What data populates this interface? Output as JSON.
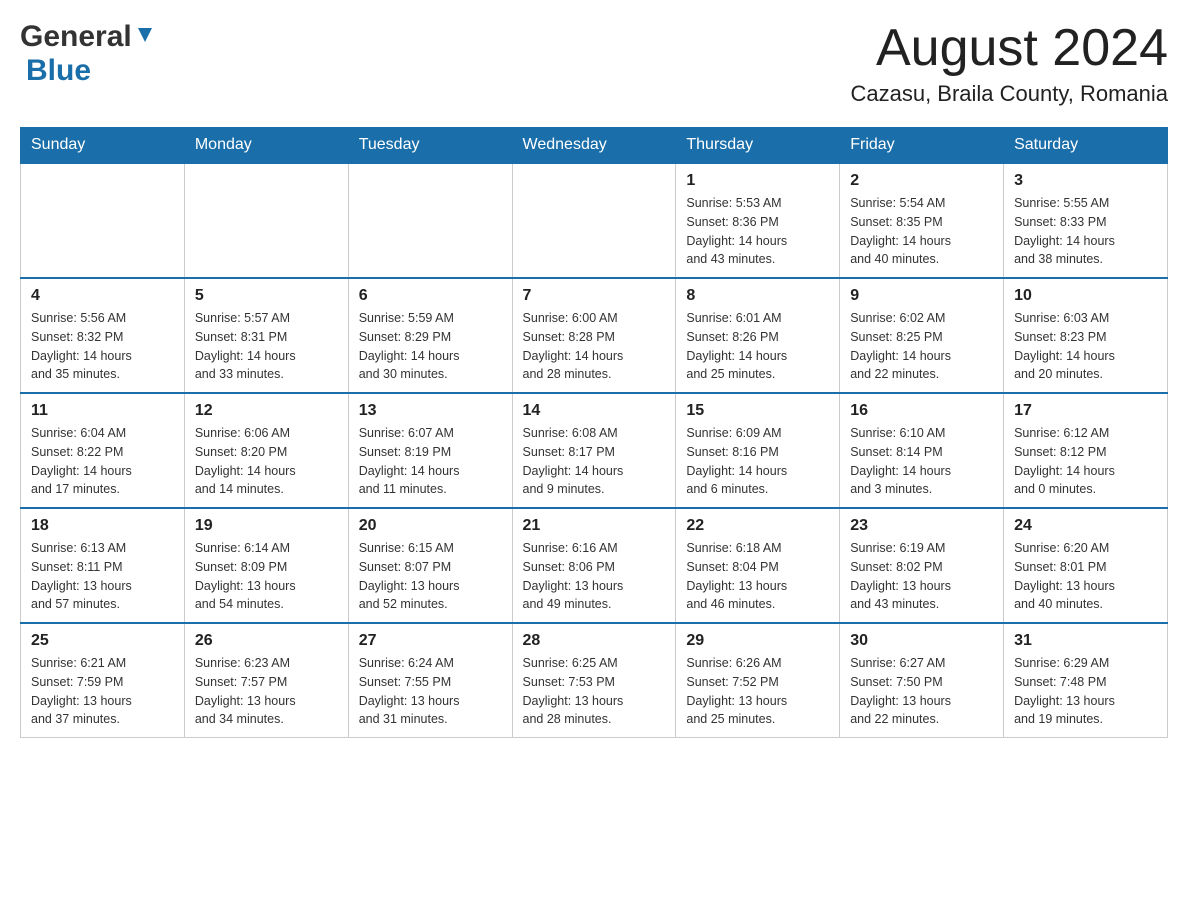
{
  "header": {
    "logo": {
      "general": "General",
      "blue": "Blue"
    },
    "title": "August 2024",
    "location": "Cazasu, Braila County, Romania"
  },
  "calendar": {
    "days_of_week": [
      "Sunday",
      "Monday",
      "Tuesday",
      "Wednesday",
      "Thursday",
      "Friday",
      "Saturday"
    ],
    "weeks": [
      {
        "days": [
          {
            "num": "",
            "info": ""
          },
          {
            "num": "",
            "info": ""
          },
          {
            "num": "",
            "info": ""
          },
          {
            "num": "",
            "info": ""
          },
          {
            "num": "1",
            "info": "Sunrise: 5:53 AM\nSunset: 8:36 PM\nDaylight: 14 hours\nand 43 minutes."
          },
          {
            "num": "2",
            "info": "Sunrise: 5:54 AM\nSunset: 8:35 PM\nDaylight: 14 hours\nand 40 minutes."
          },
          {
            "num": "3",
            "info": "Sunrise: 5:55 AM\nSunset: 8:33 PM\nDaylight: 14 hours\nand 38 minutes."
          }
        ]
      },
      {
        "days": [
          {
            "num": "4",
            "info": "Sunrise: 5:56 AM\nSunset: 8:32 PM\nDaylight: 14 hours\nand 35 minutes."
          },
          {
            "num": "5",
            "info": "Sunrise: 5:57 AM\nSunset: 8:31 PM\nDaylight: 14 hours\nand 33 minutes."
          },
          {
            "num": "6",
            "info": "Sunrise: 5:59 AM\nSunset: 8:29 PM\nDaylight: 14 hours\nand 30 minutes."
          },
          {
            "num": "7",
            "info": "Sunrise: 6:00 AM\nSunset: 8:28 PM\nDaylight: 14 hours\nand 28 minutes."
          },
          {
            "num": "8",
            "info": "Sunrise: 6:01 AM\nSunset: 8:26 PM\nDaylight: 14 hours\nand 25 minutes."
          },
          {
            "num": "9",
            "info": "Sunrise: 6:02 AM\nSunset: 8:25 PM\nDaylight: 14 hours\nand 22 minutes."
          },
          {
            "num": "10",
            "info": "Sunrise: 6:03 AM\nSunset: 8:23 PM\nDaylight: 14 hours\nand 20 minutes."
          }
        ]
      },
      {
        "days": [
          {
            "num": "11",
            "info": "Sunrise: 6:04 AM\nSunset: 8:22 PM\nDaylight: 14 hours\nand 17 minutes."
          },
          {
            "num": "12",
            "info": "Sunrise: 6:06 AM\nSunset: 8:20 PM\nDaylight: 14 hours\nand 14 minutes."
          },
          {
            "num": "13",
            "info": "Sunrise: 6:07 AM\nSunset: 8:19 PM\nDaylight: 14 hours\nand 11 minutes."
          },
          {
            "num": "14",
            "info": "Sunrise: 6:08 AM\nSunset: 8:17 PM\nDaylight: 14 hours\nand 9 minutes."
          },
          {
            "num": "15",
            "info": "Sunrise: 6:09 AM\nSunset: 8:16 PM\nDaylight: 14 hours\nand 6 minutes."
          },
          {
            "num": "16",
            "info": "Sunrise: 6:10 AM\nSunset: 8:14 PM\nDaylight: 14 hours\nand 3 minutes."
          },
          {
            "num": "17",
            "info": "Sunrise: 6:12 AM\nSunset: 8:12 PM\nDaylight: 14 hours\nand 0 minutes."
          }
        ]
      },
      {
        "days": [
          {
            "num": "18",
            "info": "Sunrise: 6:13 AM\nSunset: 8:11 PM\nDaylight: 13 hours\nand 57 minutes."
          },
          {
            "num": "19",
            "info": "Sunrise: 6:14 AM\nSunset: 8:09 PM\nDaylight: 13 hours\nand 54 minutes."
          },
          {
            "num": "20",
            "info": "Sunrise: 6:15 AM\nSunset: 8:07 PM\nDaylight: 13 hours\nand 52 minutes."
          },
          {
            "num": "21",
            "info": "Sunrise: 6:16 AM\nSunset: 8:06 PM\nDaylight: 13 hours\nand 49 minutes."
          },
          {
            "num": "22",
            "info": "Sunrise: 6:18 AM\nSunset: 8:04 PM\nDaylight: 13 hours\nand 46 minutes."
          },
          {
            "num": "23",
            "info": "Sunrise: 6:19 AM\nSunset: 8:02 PM\nDaylight: 13 hours\nand 43 minutes."
          },
          {
            "num": "24",
            "info": "Sunrise: 6:20 AM\nSunset: 8:01 PM\nDaylight: 13 hours\nand 40 minutes."
          }
        ]
      },
      {
        "days": [
          {
            "num": "25",
            "info": "Sunrise: 6:21 AM\nSunset: 7:59 PM\nDaylight: 13 hours\nand 37 minutes."
          },
          {
            "num": "26",
            "info": "Sunrise: 6:23 AM\nSunset: 7:57 PM\nDaylight: 13 hours\nand 34 minutes."
          },
          {
            "num": "27",
            "info": "Sunrise: 6:24 AM\nSunset: 7:55 PM\nDaylight: 13 hours\nand 31 minutes."
          },
          {
            "num": "28",
            "info": "Sunrise: 6:25 AM\nSunset: 7:53 PM\nDaylight: 13 hours\nand 28 minutes."
          },
          {
            "num": "29",
            "info": "Sunrise: 6:26 AM\nSunset: 7:52 PM\nDaylight: 13 hours\nand 25 minutes."
          },
          {
            "num": "30",
            "info": "Sunrise: 6:27 AM\nSunset: 7:50 PM\nDaylight: 13 hours\nand 22 minutes."
          },
          {
            "num": "31",
            "info": "Sunrise: 6:29 AM\nSunset: 7:48 PM\nDaylight: 13 hours\nand 19 minutes."
          }
        ]
      }
    ]
  }
}
